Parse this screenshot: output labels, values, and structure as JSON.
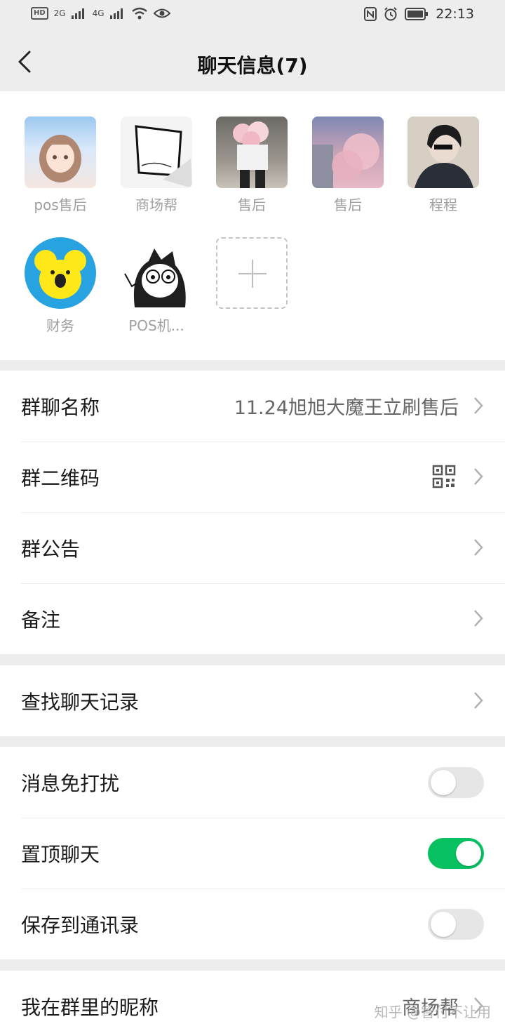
{
  "status_bar": {
    "network_1": "2G",
    "network_2": "4G",
    "time": "22:13",
    "icons": [
      "hd-icon",
      "signal-icon",
      "wifi-icon",
      "eye-icon",
      "nfc-icon",
      "alarm-icon",
      "battery-icon"
    ]
  },
  "header": {
    "title": "聊天信息(7)",
    "back_icon": "chevron-left-icon"
  },
  "members": [
    {
      "name": "pos售后"
    },
    {
      "name": "商场帮"
    },
    {
      "name": "售后"
    },
    {
      "name": "售后"
    },
    {
      "name": "程程"
    },
    {
      "name": "财务"
    },
    {
      "name": "POS机..."
    }
  ],
  "settings": {
    "group_name": {
      "label": "群聊名称",
      "value": "11.24旭旭大魔王立刷售后"
    },
    "group_qr": {
      "label": "群二维码"
    },
    "announcement": {
      "label": "群公告"
    },
    "remark": {
      "label": "备注"
    },
    "search_history": {
      "label": "查找聊天记录"
    },
    "mute": {
      "label": "消息免打扰",
      "on": false
    },
    "pin": {
      "label": "置顶聊天",
      "on": true
    },
    "save_contacts": {
      "label": "保存到通讯录",
      "on": false
    },
    "my_nickname": {
      "label": "我在群里的昵称",
      "value": "商场帮"
    }
  },
  "watermark": "知乎 @智付不让用",
  "colors": {
    "accent_green": "#07c160",
    "background": "#ededed"
  }
}
